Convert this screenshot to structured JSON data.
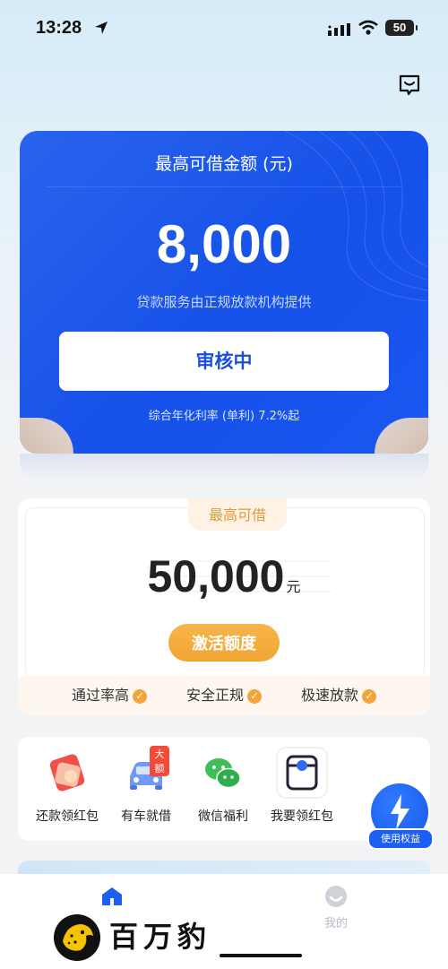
{
  "status_bar": {
    "time": "13:28",
    "battery": "50"
  },
  "loan_card": {
    "title": "最高可借金额 (元)",
    "amount": "8,000",
    "subtitle": "贷款服务由正规放款机构提供",
    "status_button": "审核中",
    "rate_text": "综合年化利率 (单利) 7.2%起"
  },
  "credit_card": {
    "tab_label": "最高可借",
    "amount": "50,000",
    "unit": "元",
    "activate_button": "激活额度",
    "features": [
      "通过率高",
      "安全正规",
      "极速放款"
    ]
  },
  "shortcuts": [
    {
      "label": "还款领红包",
      "icon": "red-envelope-icon"
    },
    {
      "label": "有车就借",
      "icon": "car-icon",
      "badge": "大额"
    },
    {
      "label": "微信福利",
      "icon": "wechat-icon"
    },
    {
      "label": "我要领红包",
      "icon": "camera-box-icon"
    }
  ],
  "floating_button": {
    "label": "使用权益",
    "icon": "lightning-icon"
  },
  "tabbar": {
    "mine_label": "我的"
  },
  "brand": {
    "name": "百万豹"
  },
  "colors": {
    "primary_blue": "#1a55ec",
    "orange": "#f2a53b",
    "light_bg": "#f2f3f5"
  }
}
